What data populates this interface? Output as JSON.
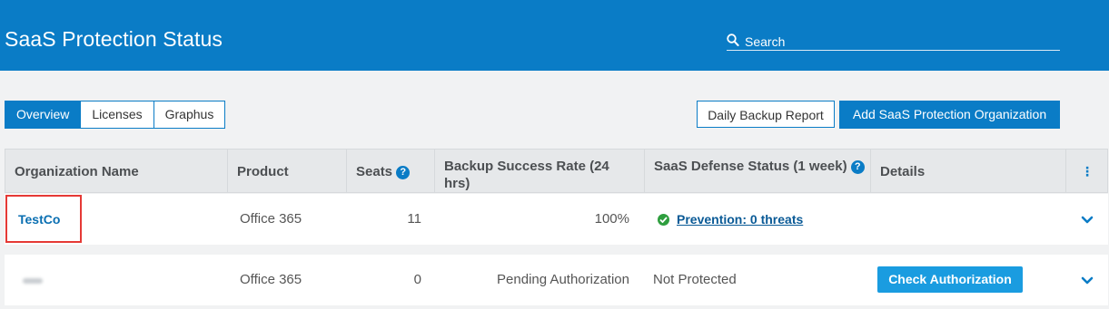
{
  "header": {
    "title": "SaaS Protection Status",
    "search_label": "Search"
  },
  "tabs": [
    {
      "label": "Overview",
      "active": true
    },
    {
      "label": "Licenses",
      "active": false
    },
    {
      "label": "Graphus",
      "active": false
    }
  ],
  "actions": {
    "daily_report": "Daily Backup Report",
    "add_org": "Add SaaS Protection Organization"
  },
  "table": {
    "columns": [
      "Organization Name",
      "Product",
      "Seats",
      "Backup Success Rate (24 hrs)",
      "SaaS Defense Status (1 week)",
      "Details"
    ],
    "more_icon": "⋮",
    "rows": [
      {
        "organization": "TestCo",
        "product": "Office 365",
        "seats": "11",
        "backup_rate": "100%",
        "defense_status": "Prevention: 0 threats",
        "details": ""
      },
      {
        "organization": "",
        "product": "Office 365",
        "seats": "0",
        "backup_rate": "Pending Authorization",
        "defense_status": "Not Protected",
        "details": "Check Authorization"
      }
    ]
  },
  "colors": {
    "brand_blue": "#0a7cc6",
    "status_green": "#2e9e3e",
    "highlight_red": "#e53935"
  }
}
